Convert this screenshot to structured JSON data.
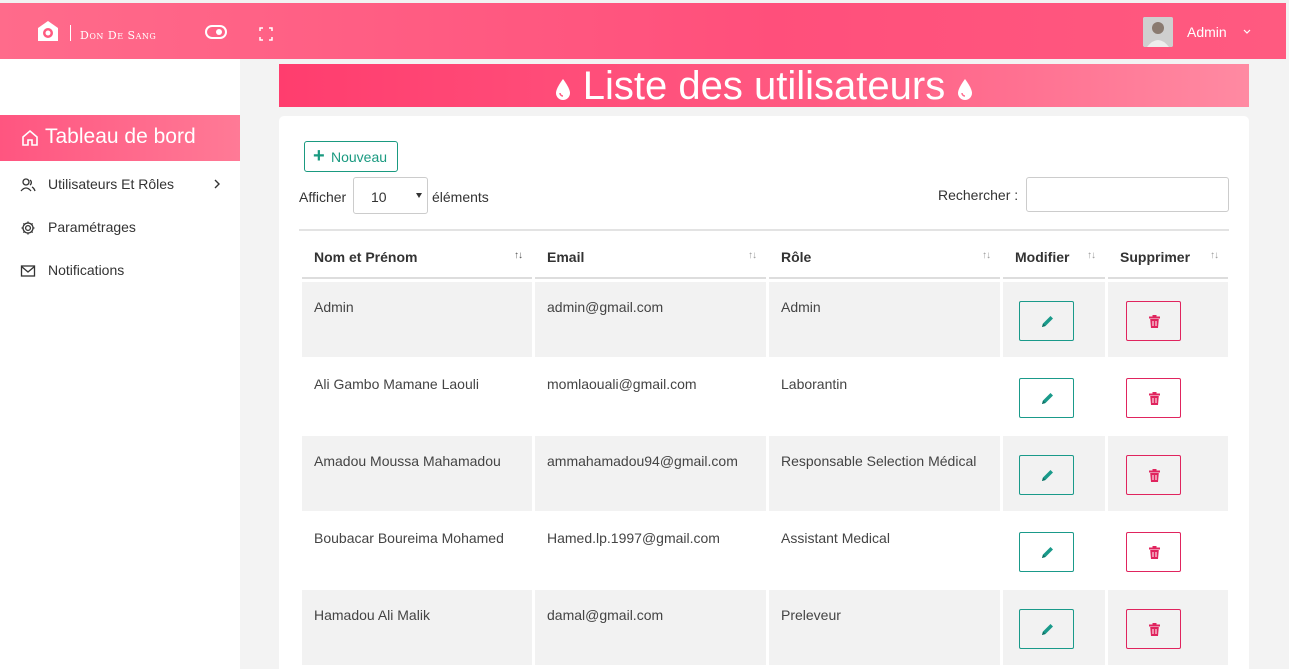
{
  "header": {
    "brand": "Don De Sang",
    "user_name": "Admin"
  },
  "sidebar": {
    "items": [
      {
        "label": "Tableau de bord",
        "icon": "home-icon",
        "active": true
      },
      {
        "label": "Utilisateurs Et Rôles",
        "icon": "users-icon",
        "has_submenu": true
      },
      {
        "label": "Paramétrages",
        "icon": "gear-icon"
      },
      {
        "label": "Notifications",
        "icon": "mail-icon"
      }
    ]
  },
  "page": {
    "title": "Liste des utilisateurs"
  },
  "toolbar": {
    "new_button": "Nouveau",
    "show_label": "Afficher",
    "show_value": "10",
    "elements_label": "éléments",
    "search_label": "Rechercher :",
    "search_value": ""
  },
  "table": {
    "columns": [
      "Nom et Prénom",
      "Email",
      "Rôle",
      "Modifier",
      "Supprimer"
    ],
    "rows": [
      {
        "name": "Admin",
        "email": "admin@gmail.com",
        "role": "Admin"
      },
      {
        "name": "Ali Gambo Mamane Laouli",
        "email": "momlaouali@gmail.com",
        "role": "Laborantin"
      },
      {
        "name": "Amadou Moussa Mahamadou",
        "email": "ammahamadou94@gmail.com",
        "role": "Responsable Selection Médical"
      },
      {
        "name": "Boubacar Boureima Mohamed",
        "email": "Hamed.lp.1997@gmail.com",
        "role": "Assistant Medical"
      },
      {
        "name": "Hamadou Ali Malik",
        "email": "damal@gmail.com",
        "role": "Preleveur"
      }
    ]
  },
  "colors": {
    "accent": "#ff4f7b",
    "edit": "#1a9a8a",
    "delete": "#e0245e"
  }
}
